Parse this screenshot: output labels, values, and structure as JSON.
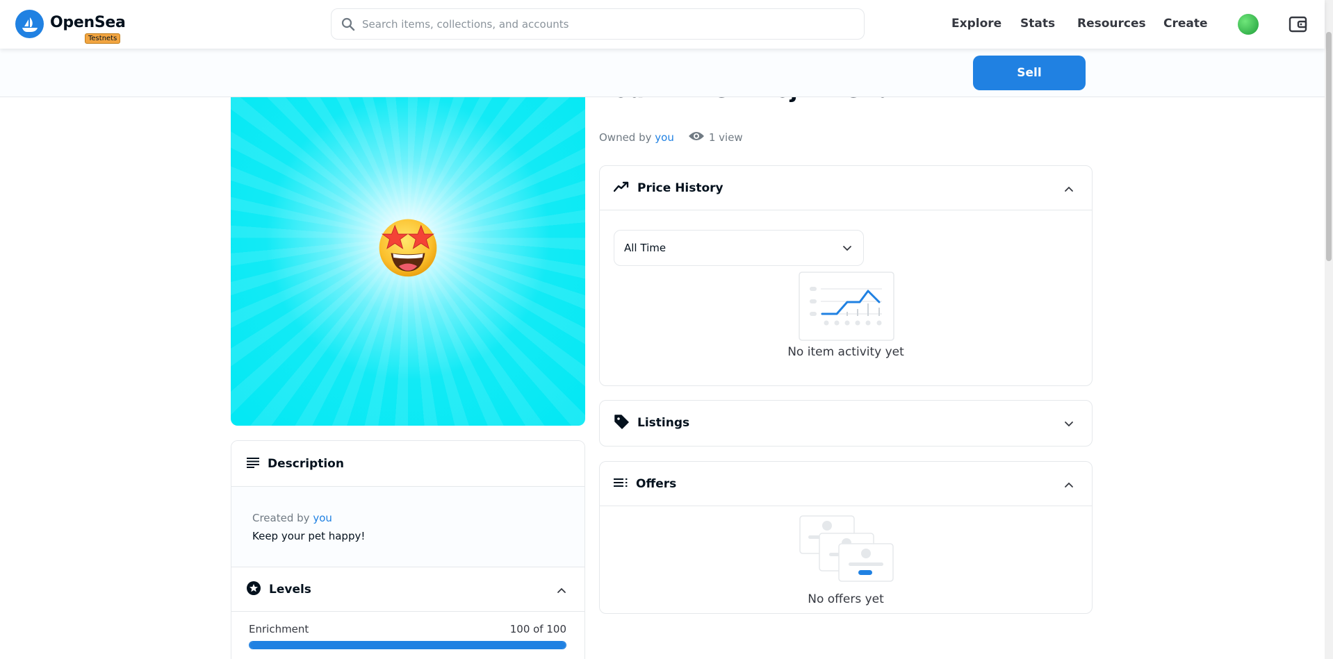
{
  "brand": {
    "name": "OpenSea",
    "badge": "Testnets"
  },
  "search": {
    "placeholder": "Search items, collections, and accounts",
    "value": ""
  },
  "nav": {
    "explore": "Explore",
    "stats": "Stats",
    "resources": "Resources",
    "create": "Create"
  },
  "subheader": {
    "sell_label": "Sell"
  },
  "item": {
    "title": "Your Little Emoji Friend",
    "owned_prefix": "Owned by",
    "owner": "you",
    "views": "1 view",
    "image_emoji": "star-struck-emoji"
  },
  "description": {
    "title": "Description",
    "created_prefix": "Created by",
    "creator": "you",
    "text": "Keep your pet happy!"
  },
  "levels": {
    "title": "Levels",
    "items": [
      {
        "name": "Enrichment",
        "value": "100 of 100",
        "fraction": 1.0
      }
    ]
  },
  "price_history": {
    "title": "Price History",
    "period": "All Time",
    "empty": "No item activity yet"
  },
  "listings": {
    "title": "Listings"
  },
  "offers": {
    "title": "Offers",
    "empty": "No offers yet"
  },
  "colors": {
    "accent": "#2081e2",
    "text": "#04111d",
    "muted": "#707a83",
    "border": "#e5e8eb",
    "badge": "#f2a541"
  }
}
